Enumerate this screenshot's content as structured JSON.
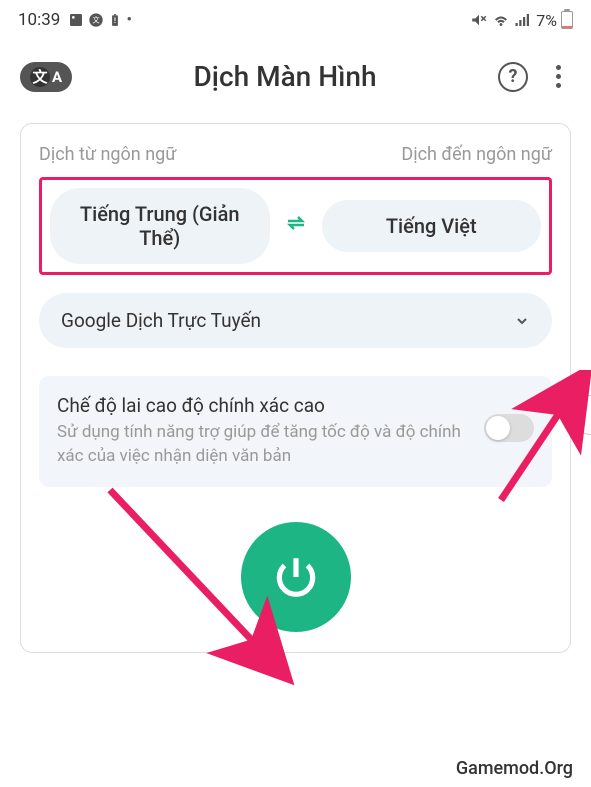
{
  "status": {
    "time": "10:39",
    "battery_percent": "7%"
  },
  "header": {
    "title": "Dịch Màn Hình",
    "translate_badge_1": "文",
    "translate_badge_2": "A"
  },
  "lang": {
    "from_label": "Dịch từ ngôn ngữ",
    "to_label": "Dịch đến ngôn ngữ",
    "from_value": "Tiếng Trung (Giản Thể)",
    "to_value": "Tiếng Việt"
  },
  "provider": {
    "name": "Google Dịch Trực Tuyến"
  },
  "hybrid": {
    "title": "Chế độ lai cao độ chính xác cao",
    "desc": "Sử dụng tính năng trợ giúp để tăng tốc độ và độ chính xác của việc nhận diện văn bản"
  },
  "watermark": "Gamemod.Org"
}
